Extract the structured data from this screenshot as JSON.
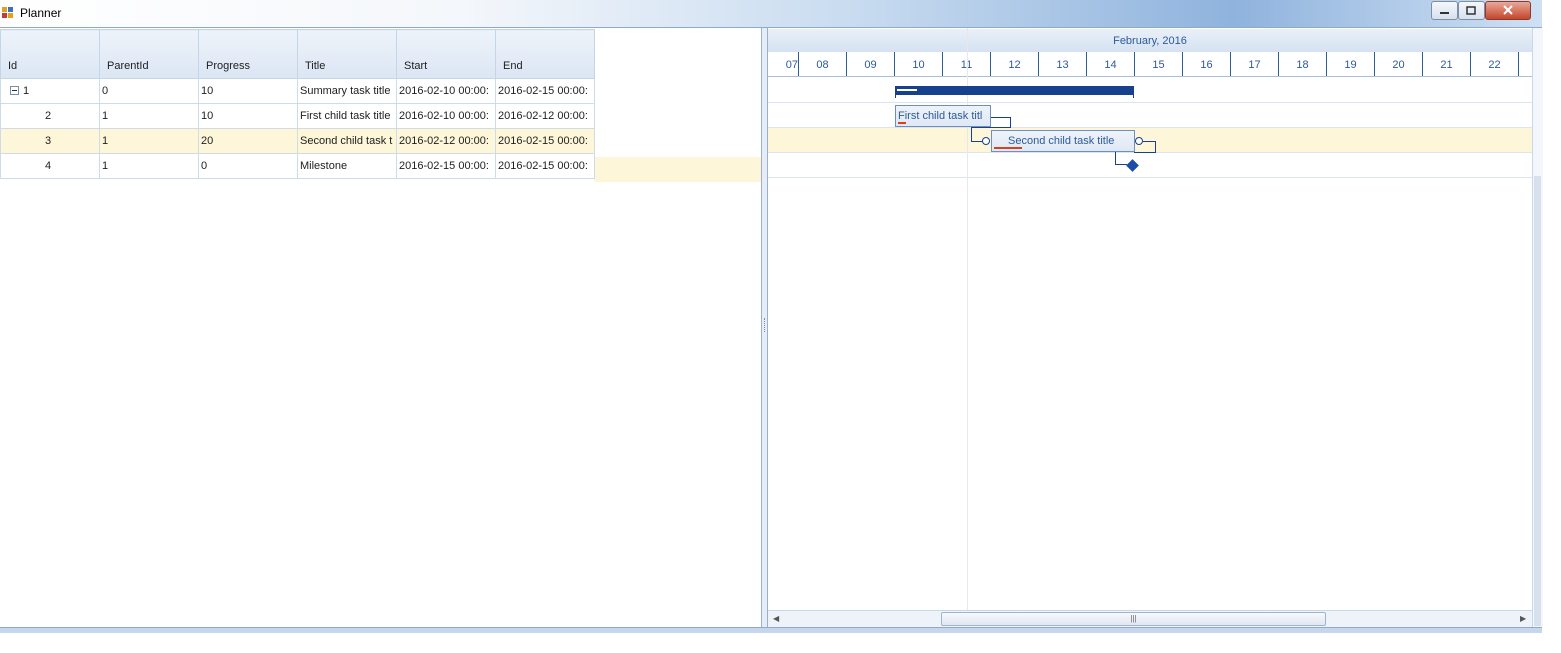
{
  "window": {
    "title": "Planner"
  },
  "grid": {
    "columns": [
      "Id",
      "ParentId",
      "Progress",
      "Title",
      "Start",
      "End"
    ],
    "rows": [
      {
        "id": "1",
        "parent": "0",
        "progress": "10",
        "title": "Summary task title",
        "start": "2016-02-10 00:00:",
        "end": "2016-02-15 00:00:",
        "expander": "collapse"
      },
      {
        "id": "2",
        "parent": "1",
        "progress": "10",
        "title": "First child task title",
        "start": "2016-02-10 00:00:",
        "end": "2016-02-12 00:00:"
      },
      {
        "id": "3",
        "parent": "1",
        "progress": "20",
        "title": "Second child task t",
        "start": "2016-02-12 00:00:",
        "end": "2016-02-15 00:00:",
        "selected": true
      },
      {
        "id": "4",
        "parent": "1",
        "progress": "0",
        "title": "Milestone",
        "start": "2016-02-15 00:00:",
        "end": "2016-02-15 00:00:"
      }
    ]
  },
  "gantt": {
    "month": "February, 2016",
    "days": [
      "07",
      "08",
      "09",
      "10",
      "11",
      "12",
      "13",
      "14",
      "15",
      "16",
      "17",
      "18",
      "19",
      "20",
      "21",
      "22"
    ],
    "bars": {
      "first_child": "First child task titl",
      "second_child": "Second child task title"
    }
  },
  "colors": {
    "accent": "#17418c",
    "selection": "#fdf6d8",
    "progress": "#d9401b"
  }
}
